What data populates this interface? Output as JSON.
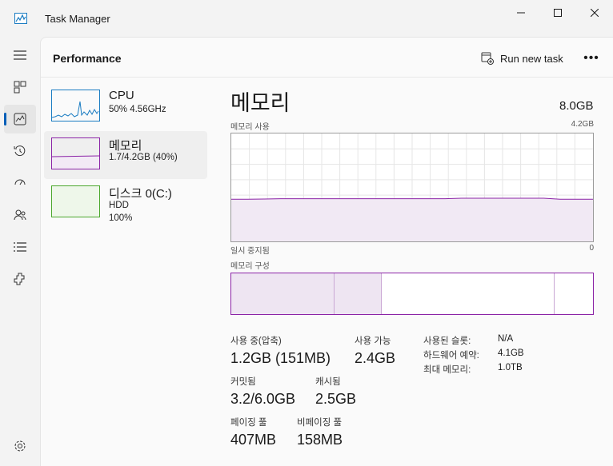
{
  "window": {
    "title": "Task Manager"
  },
  "rail": {
    "items": [
      {
        "icon": "hamburger-menu-icon"
      },
      {
        "icon": "processes-icon"
      },
      {
        "icon": "performance-icon"
      },
      {
        "icon": "app-history-icon"
      },
      {
        "icon": "startup-apps-icon"
      },
      {
        "icon": "users-icon"
      },
      {
        "icon": "details-icon"
      },
      {
        "icon": "services-icon"
      },
      {
        "icon": "settings-icon"
      }
    ],
    "active_index": 2
  },
  "header": {
    "title": "Performance",
    "run_task_label": "Run new task",
    "more_label": "•••"
  },
  "devices": [
    {
      "name": "CPU",
      "line2": "50%  4.56GHz",
      "line3": "",
      "color": "#1a7cc2",
      "selected": false
    },
    {
      "name": "메모리",
      "line2": "1.7/4.2GB (40%)",
      "line3": "",
      "color": "#8b23a6",
      "selected": true
    },
    {
      "name": "디스크 0(C:)",
      "line2": "HDD",
      "line3": "100%",
      "color": "#4aa72c",
      "selected": false
    }
  ],
  "detail": {
    "title": "메모리",
    "total": "8.0GB",
    "usage_label": "메모리 사용",
    "usage_max": "4.2GB",
    "time_label": "일시 중지됨",
    "time_min": "0",
    "composition_label": "메모리 구성",
    "accent": "#8b23a6"
  },
  "usage_chart": {
    "max_gb": 4.2,
    "values_gb": [
      1.64,
      1.64,
      1.65,
      1.66,
      1.66,
      1.66,
      1.66,
      1.66,
      1.66,
      1.66,
      1.66,
      1.66,
      1.66,
      1.66,
      1.68,
      1.68,
      1.68,
      1.68,
      1.68,
      1.68,
      1.64,
      1.64,
      1.64
    ]
  },
  "composition": {
    "in_use_fraction": 0.286,
    "modified_fraction": 0.13,
    "standby_fraction": 0.478,
    "free_fraction": 0.106
  },
  "stats": {
    "in_use_label": "사용 중(압축)",
    "in_use_value": "1.2GB (151MB)",
    "available_label": "사용 가능",
    "available_value": "2.4GB",
    "committed_label": "커밋됨",
    "committed_value": "3.2/6.0GB",
    "cached_label": "캐시됨",
    "cached_value": "2.5GB",
    "paged_label": "페이징 풀",
    "paged_value": "407MB",
    "nonpaged_label": "비페이징 풀",
    "nonpaged_value": "158MB"
  },
  "kv": [
    {
      "key": "사용된 슬롯:",
      "value": "N/A"
    },
    {
      "key": "하드웨어 예약:",
      "value": "4.1GB"
    },
    {
      "key": "최대 메모리:",
      "value": "1.0TB"
    }
  ]
}
